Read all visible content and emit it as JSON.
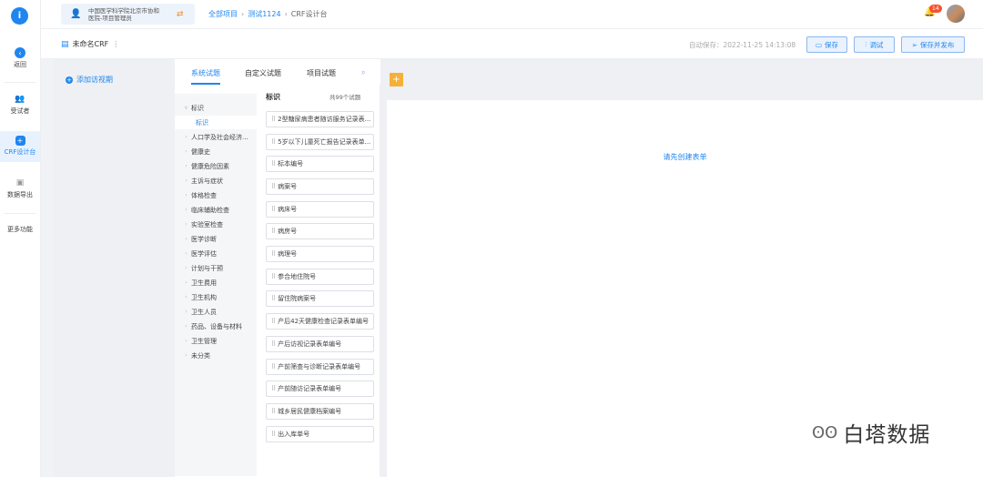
{
  "rail": {
    "logo": "i",
    "items": [
      {
        "label": "返回",
        "icon": "back-arrow-icon"
      },
      {
        "label": "受试者",
        "icon": "people-icon"
      },
      {
        "label": "CRF设计台",
        "icon": "crf-design-icon"
      },
      {
        "label": "数据导出",
        "icon": "export-icon"
      },
      {
        "label": "更多功能",
        "icon": ""
      }
    ]
  },
  "header": {
    "org_line1": "中国医学科学院北京市协和",
    "org_line2": "医院-项目管理员",
    "breadcrumb": [
      "全部项目",
      "测试1124",
      "CRF设计台"
    ],
    "notification_count": "14"
  },
  "subheader": {
    "crf_name": "未命名CRF",
    "autosave": "自动保存：2022-11-25 14:13:08",
    "save_label": "保存",
    "debug_label": "调试",
    "publish_label": "保存并发布"
  },
  "visit": {
    "add_label": "添加访视期"
  },
  "library": {
    "tabs": [
      "系统试题",
      "自定义试题",
      "项目试题"
    ],
    "categories": [
      "标识",
      "标识",
      "人口学及社会经济...",
      "健康史",
      "健康危险因素",
      "主诉与症状",
      "体格检查",
      "临床辅助检查",
      "实验室检查",
      "医学诊断",
      "医学评估",
      "计划与干预",
      "卫生费用",
      "卫生机构",
      "卫生人员",
      "药品、设备与材料",
      "卫生管理",
      "未分类"
    ],
    "field_header": "标识",
    "field_count": "共99个试题",
    "fields": [
      "2型糖尿病患者随访服务记录表...",
      "5岁以下儿童死亡报告记录表单...",
      "标本编号",
      "病案号",
      "病床号",
      "病房号",
      "病理号",
      "参合地住院号",
      "留住院病案号",
      "产后42天健康检查记录表单编号",
      "产后访视记录表单编号",
      "产前筛查与诊断记录表单编号",
      "产前随访记录表单编号",
      "城乡居民健康档案编号",
      "出入库单号"
    ]
  },
  "canvas": {
    "hint": "请先创建表单"
  },
  "watermark": {
    "text": "白塔数据"
  }
}
